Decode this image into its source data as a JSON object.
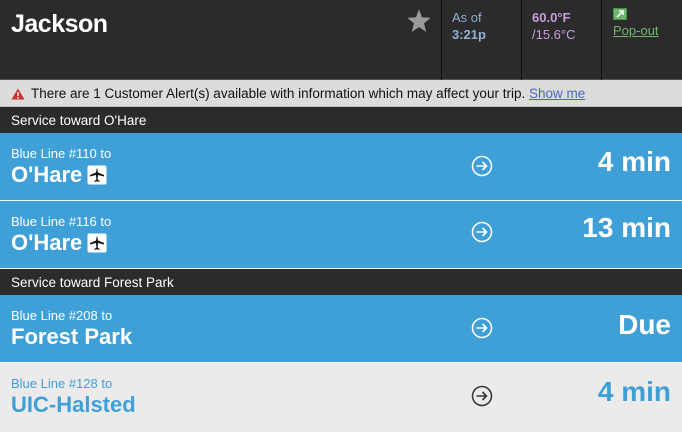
{
  "header": {
    "station": "Jackson",
    "favorite_icon": "star-icon",
    "as_of_label": "As of",
    "as_of_time": "3:21p",
    "temp_f": "60.0°F",
    "temp_c": "/15.6°C",
    "popout_label": "Pop-out",
    "popout_icon": "external-link-icon"
  },
  "alert": {
    "icon": "warning-icon",
    "text": "There are 1 Customer Alert(s) available with information which may affect your trip.",
    "link": "Show me"
  },
  "sections": [
    {
      "title": "Service toward O'Hare",
      "arrivals": [
        {
          "line": "Blue Line #110 to",
          "destination": "O'Hare",
          "airport": true,
          "eta": "4 min",
          "style": "blue"
        },
        {
          "line": "Blue Line #116 to",
          "destination": "O'Hare",
          "airport": true,
          "eta": "13 min",
          "style": "blue"
        }
      ]
    },
    {
      "title": "Service toward Forest Park",
      "arrivals": [
        {
          "line": "Blue Line #208 to",
          "destination": "Forest Park",
          "airport": false,
          "eta": "Due",
          "style": "blue"
        },
        {
          "line": "Blue Line #128 to",
          "destination": "UIC-Halsted",
          "airport": false,
          "eta": "4 min",
          "style": "grey"
        }
      ]
    }
  ],
  "colors": {
    "header_bg": "#2b2b2b",
    "row_blue": "#3fa0d8",
    "row_grey": "#ebebeb",
    "alert_bg": "#dcdcdc",
    "time_color": "#8fb0d8",
    "temp_color": "#c99ee0",
    "popout_color": "#6fb56f"
  }
}
